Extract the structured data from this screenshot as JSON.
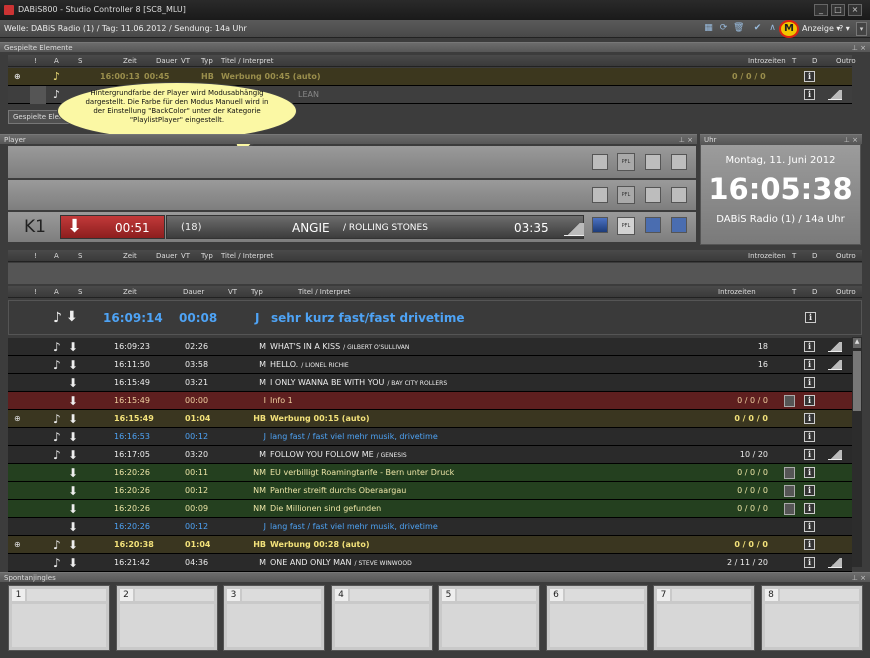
{
  "window": {
    "title": "DABiS800 - Studio Controller 8 [SC8_MLU]"
  },
  "status": {
    "text": "Welle: DABiS Radio (1) / Tag: 11.06.2012 / Sendung: 14a Uhr",
    "mode_label": "M",
    "anzeige": "Anzeige ▾",
    "help": "? ▾"
  },
  "played": {
    "panel_title": "Gespielte Elemente",
    "tab_label": "Gespielte Elemente",
    "columns": [
      "!",
      "A",
      "S",
      "Zeit",
      "Dauer",
      "VT",
      "Typ",
      "Titel / Interpret",
      "Introzeiten",
      "T",
      "D",
      "Outro"
    ],
    "row1": {
      "zeit": "16:00:13",
      "dauer": "00:45",
      "typ": "HB",
      "titel": "Werbung 00:45 (auto)",
      "intro": "0 / 0 / 0"
    },
    "row2": {
      "titel": "LEAN"
    }
  },
  "bubble": {
    "text": "Hintergrundfarbe der Player wird Modusabhängig dargestellt. Die Farbe für den Modus Manuell wird in der Einstellung \"BackColor\" unter der Kategorie \"PlaylistPlayer\" eingestellt."
  },
  "player": {
    "panel_title": "Player",
    "channel": "K1",
    "remaining": "00:51",
    "count": "(18)",
    "title": "ANGIE",
    "artist": "/ ROLLING STONES",
    "duration": "03:35",
    "pfl": "PFL"
  },
  "clock": {
    "panel_title": "Uhr",
    "date": "Montag, 11. Juni 2012",
    "time": "16:05:38",
    "station": "DABiS Radio (1) / 14a Uhr"
  },
  "playlist": {
    "columns": [
      "!",
      "A",
      "S",
      "Zeit",
      "Dauer",
      "VT",
      "Typ",
      "Titel / Interpret",
      "Introzeiten",
      "T",
      "D",
      "Outro"
    ],
    "current": {
      "zeit": "16:09:14",
      "dauer": "00:08",
      "typ": "J",
      "titel": "sehr kurz fast/fast drivetime"
    },
    "rows": [
      {
        "style": "grey",
        "a": true,
        "zeit": "16:09:23",
        "dauer": "02:26",
        "typ": "M",
        "titel": "WHAT'S IN A KISS",
        "artist": "/ GILBERT O'SULLIVAN",
        "intro": "18",
        "doc": false,
        "outro": true
      },
      {
        "style": "grey",
        "a": true,
        "zeit": "16:11:50",
        "dauer": "03:58",
        "typ": "M",
        "titel": "HELLO.",
        "artist": "/ LIONEL RICHIE",
        "intro": "16",
        "doc": false,
        "outro": true
      },
      {
        "style": "grey",
        "a": false,
        "zeit": "16:15:49",
        "dauer": "03:21",
        "typ": "M",
        "titel": "I ONLY WANNA BE WITH YOU",
        "artist": "/ BAY CITY ROLLERS",
        "intro": "",
        "doc": false,
        "outro": false
      },
      {
        "style": "red",
        "a": false,
        "zeit": "16:15:49",
        "dauer": "00:00",
        "typ": "I",
        "titel": "Info 1",
        "artist": "",
        "intro": "0 / 0 / 0",
        "doc": true,
        "outro": false
      },
      {
        "style": "yel",
        "a": true,
        "plus": true,
        "zeit": "16:15:49",
        "dauer": "01:04",
        "typ": "HB",
        "titel": "Werbung 00:15 (auto)",
        "artist": "",
        "intro": "0 / 0 / 0",
        "doc": false,
        "outro": false
      },
      {
        "style": "blue",
        "a": true,
        "zeit": "16:16:53",
        "dauer": "00:12",
        "typ": "J",
        "titel": "lang fast / fast viel mehr musik, drivetime",
        "artist": "",
        "intro": "",
        "doc": false,
        "outro": false
      },
      {
        "style": "grey",
        "a": true,
        "zeit": "16:17:05",
        "dauer": "03:20",
        "typ": "M",
        "titel": "FOLLOW YOU FOLLOW ME",
        "artist": "/ GENESIS",
        "intro": "10 / 20",
        "doc": false,
        "outro": true
      },
      {
        "style": "green",
        "a": false,
        "zeit": "16:20:26",
        "dauer": "00:11",
        "typ": "NM",
        "titel": "EU verbilligt Roamingtarife - Bern unter Druck",
        "artist": "",
        "intro": "0 / 0 / 0",
        "doc": true,
        "outro": false
      },
      {
        "style": "green",
        "a": false,
        "zeit": "16:20:26",
        "dauer": "00:12",
        "typ": "NM",
        "titel": "Panther streift durchs Oberaargau",
        "artist": "",
        "intro": "0 / 0 / 0",
        "doc": true,
        "outro": false
      },
      {
        "style": "green",
        "a": false,
        "zeit": "16:20:26",
        "dauer": "00:09",
        "typ": "NM",
        "titel": "Die Millionen sind gefunden",
        "artist": "",
        "intro": "0 / 0 / 0",
        "doc": true,
        "outro": false
      },
      {
        "style": "blue",
        "a": false,
        "zeit": "16:20:26",
        "dauer": "00:12",
        "typ": "J",
        "titel": "lang fast / fast viel mehr musik, drivetime",
        "artist": "",
        "intro": "",
        "doc": false,
        "outro": false
      },
      {
        "style": "yel",
        "a": true,
        "plus": true,
        "zeit": "16:20:38",
        "dauer": "01:04",
        "typ": "HB",
        "titel": "Werbung 00:28 (auto)",
        "artist": "",
        "intro": "0 / 0 / 0",
        "doc": false,
        "outro": false
      },
      {
        "style": "grey",
        "a": true,
        "zeit": "16:21:42",
        "dauer": "04:36",
        "typ": "M",
        "titel": "ONE AND ONLY MAN",
        "artist": "/ STEVE WINWOOD",
        "intro": "2 / 11 / 20",
        "doc": false,
        "outro": true
      }
    ]
  },
  "spontan": {
    "panel_title": "Spontanjingles",
    "slots": [
      "1",
      "2",
      "3",
      "4",
      "5",
      "6",
      "7",
      "8"
    ]
  }
}
